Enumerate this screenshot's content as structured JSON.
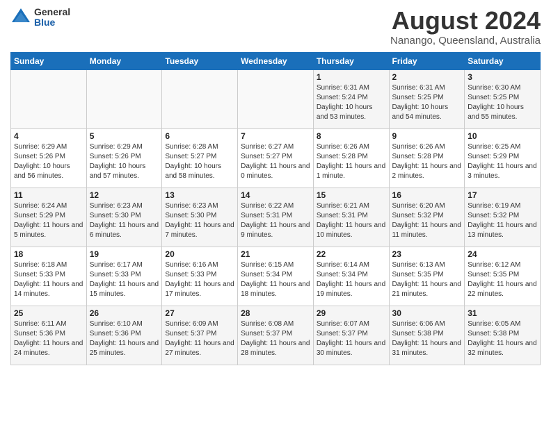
{
  "header": {
    "logo_general": "General",
    "logo_blue": "Blue",
    "month_title": "August 2024",
    "location": "Nanango, Queensland, Australia"
  },
  "weekdays": [
    "Sunday",
    "Monday",
    "Tuesday",
    "Wednesday",
    "Thursday",
    "Friday",
    "Saturday"
  ],
  "weeks": [
    [
      {
        "day": "",
        "info": ""
      },
      {
        "day": "",
        "info": ""
      },
      {
        "day": "",
        "info": ""
      },
      {
        "day": "",
        "info": ""
      },
      {
        "day": "1",
        "info": "Sunrise: 6:31 AM\nSunset: 5:24 PM\nDaylight: 10 hours and 53 minutes."
      },
      {
        "day": "2",
        "info": "Sunrise: 6:31 AM\nSunset: 5:25 PM\nDaylight: 10 hours and 54 minutes."
      },
      {
        "day": "3",
        "info": "Sunrise: 6:30 AM\nSunset: 5:25 PM\nDaylight: 10 hours and 55 minutes."
      }
    ],
    [
      {
        "day": "4",
        "info": "Sunrise: 6:29 AM\nSunset: 5:26 PM\nDaylight: 10 hours and 56 minutes."
      },
      {
        "day": "5",
        "info": "Sunrise: 6:29 AM\nSunset: 5:26 PM\nDaylight: 10 hours and 57 minutes."
      },
      {
        "day": "6",
        "info": "Sunrise: 6:28 AM\nSunset: 5:27 PM\nDaylight: 10 hours and 58 minutes."
      },
      {
        "day": "7",
        "info": "Sunrise: 6:27 AM\nSunset: 5:27 PM\nDaylight: 11 hours and 0 minutes."
      },
      {
        "day": "8",
        "info": "Sunrise: 6:26 AM\nSunset: 5:28 PM\nDaylight: 11 hours and 1 minute."
      },
      {
        "day": "9",
        "info": "Sunrise: 6:26 AM\nSunset: 5:28 PM\nDaylight: 11 hours and 2 minutes."
      },
      {
        "day": "10",
        "info": "Sunrise: 6:25 AM\nSunset: 5:29 PM\nDaylight: 11 hours and 3 minutes."
      }
    ],
    [
      {
        "day": "11",
        "info": "Sunrise: 6:24 AM\nSunset: 5:29 PM\nDaylight: 11 hours and 5 minutes."
      },
      {
        "day": "12",
        "info": "Sunrise: 6:23 AM\nSunset: 5:30 PM\nDaylight: 11 hours and 6 minutes."
      },
      {
        "day": "13",
        "info": "Sunrise: 6:23 AM\nSunset: 5:30 PM\nDaylight: 11 hours and 7 minutes."
      },
      {
        "day": "14",
        "info": "Sunrise: 6:22 AM\nSunset: 5:31 PM\nDaylight: 11 hours and 9 minutes."
      },
      {
        "day": "15",
        "info": "Sunrise: 6:21 AM\nSunset: 5:31 PM\nDaylight: 11 hours and 10 minutes."
      },
      {
        "day": "16",
        "info": "Sunrise: 6:20 AM\nSunset: 5:32 PM\nDaylight: 11 hours and 11 minutes."
      },
      {
        "day": "17",
        "info": "Sunrise: 6:19 AM\nSunset: 5:32 PM\nDaylight: 11 hours and 13 minutes."
      }
    ],
    [
      {
        "day": "18",
        "info": "Sunrise: 6:18 AM\nSunset: 5:33 PM\nDaylight: 11 hours and 14 minutes."
      },
      {
        "day": "19",
        "info": "Sunrise: 6:17 AM\nSunset: 5:33 PM\nDaylight: 11 hours and 15 minutes."
      },
      {
        "day": "20",
        "info": "Sunrise: 6:16 AM\nSunset: 5:33 PM\nDaylight: 11 hours and 17 minutes."
      },
      {
        "day": "21",
        "info": "Sunrise: 6:15 AM\nSunset: 5:34 PM\nDaylight: 11 hours and 18 minutes."
      },
      {
        "day": "22",
        "info": "Sunrise: 6:14 AM\nSunset: 5:34 PM\nDaylight: 11 hours and 19 minutes."
      },
      {
        "day": "23",
        "info": "Sunrise: 6:13 AM\nSunset: 5:35 PM\nDaylight: 11 hours and 21 minutes."
      },
      {
        "day": "24",
        "info": "Sunrise: 6:12 AM\nSunset: 5:35 PM\nDaylight: 11 hours and 22 minutes."
      }
    ],
    [
      {
        "day": "25",
        "info": "Sunrise: 6:11 AM\nSunset: 5:36 PM\nDaylight: 11 hours and 24 minutes."
      },
      {
        "day": "26",
        "info": "Sunrise: 6:10 AM\nSunset: 5:36 PM\nDaylight: 11 hours and 25 minutes."
      },
      {
        "day": "27",
        "info": "Sunrise: 6:09 AM\nSunset: 5:37 PM\nDaylight: 11 hours and 27 minutes."
      },
      {
        "day": "28",
        "info": "Sunrise: 6:08 AM\nSunset: 5:37 PM\nDaylight: 11 hours and 28 minutes."
      },
      {
        "day": "29",
        "info": "Sunrise: 6:07 AM\nSunset: 5:37 PM\nDaylight: 11 hours and 30 minutes."
      },
      {
        "day": "30",
        "info": "Sunrise: 6:06 AM\nSunset: 5:38 PM\nDaylight: 11 hours and 31 minutes."
      },
      {
        "day": "31",
        "info": "Sunrise: 6:05 AM\nSunset: 5:38 PM\nDaylight: 11 hours and 32 minutes."
      }
    ]
  ]
}
